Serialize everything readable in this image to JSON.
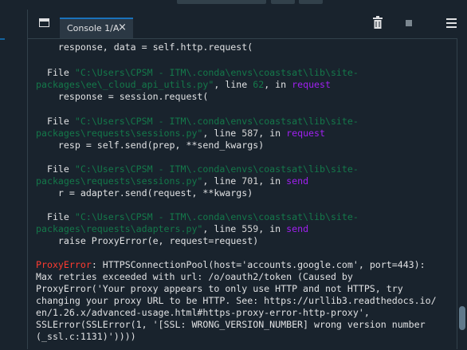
{
  "tab": {
    "label": "Console 1/A",
    "close": "×"
  },
  "icons": {
    "window": "window-icon",
    "trash": "trash-icon",
    "stop": "stop-icon",
    "menu": "hamburger-menu-icon",
    "close": "close-icon"
  },
  "colors": {
    "background": "#19232d",
    "text": "#e0e1e3",
    "path": "#14784a",
    "function": "#a020f0",
    "error": "#ff3b30",
    "tab_accent": "#1a72bb"
  },
  "console": {
    "l0": "    response, data = self.http.request(",
    "f1_file": "  File ",
    "f1_path_a": "\"C:\\Users\\CPSM - ITM\\.conda\\envs\\coastsat\\lib\\site-",
    "f1_path_b": "packages\\ee\\_cloud_api_utils.py\"",
    "f1_line": ", line ",
    "f1_num": "62",
    "f1_in": ", in ",
    "f1_func": "request",
    "f1_code": "    response = session.request(",
    "f2_file": "  File ",
    "f2_path_a": "\"C:\\Users\\CPSM - ITM\\.conda\\envs\\coastsat\\lib\\site-",
    "f2_path_b": "packages\\requests\\sessions.py\"",
    "f2_line": ", line ",
    "f2_num": "587",
    "f2_in": ", in ",
    "f2_func": "request",
    "f2_code": "    resp = self.send(prep, **send_kwargs)",
    "f3_file": "  File ",
    "f3_path_a": "\"C:\\Users\\CPSM - ITM\\.conda\\envs\\coastsat\\lib\\site-",
    "f3_path_b": "packages\\requests\\sessions.py\"",
    "f3_line": ", line ",
    "f3_num": "701",
    "f3_in": ", in ",
    "f3_func": "send",
    "f3_code": "    r = adapter.send(request, **kwargs)",
    "f4_file": "  File ",
    "f4_path_a": "\"C:\\Users\\CPSM - ITM\\.conda\\envs\\coastsat\\lib\\site-",
    "f4_path_b": "packages\\requests\\adapters.py\"",
    "f4_line": ", line ",
    "f4_num": "559",
    "f4_in": ", in ",
    "f4_func": "send",
    "f4_code": "    raise ProxyError(e, request=request)",
    "err_name": "ProxyError",
    "err_1": ": HTTPSConnectionPool(host='accounts.google.com', port=443):",
    "err_2": "Max retries exceeded with url: /o/oauth2/token (Caused by",
    "err_3": "ProxyError('Your proxy appears to only use HTTP and not HTTPS, try",
    "err_4": "changing your proxy URL to be HTTP. See: https://urllib3.readthedocs.io/",
    "err_5": "en/1.26.x/advanced-usage.html#https-proxy-error-http-proxy',",
    "err_6": "SSLError(SSLError(1, '[SSL: WRONG_VERSION_NUMBER] wrong version number",
    "err_7": "(_ssl.c:1131)'))))"
  }
}
